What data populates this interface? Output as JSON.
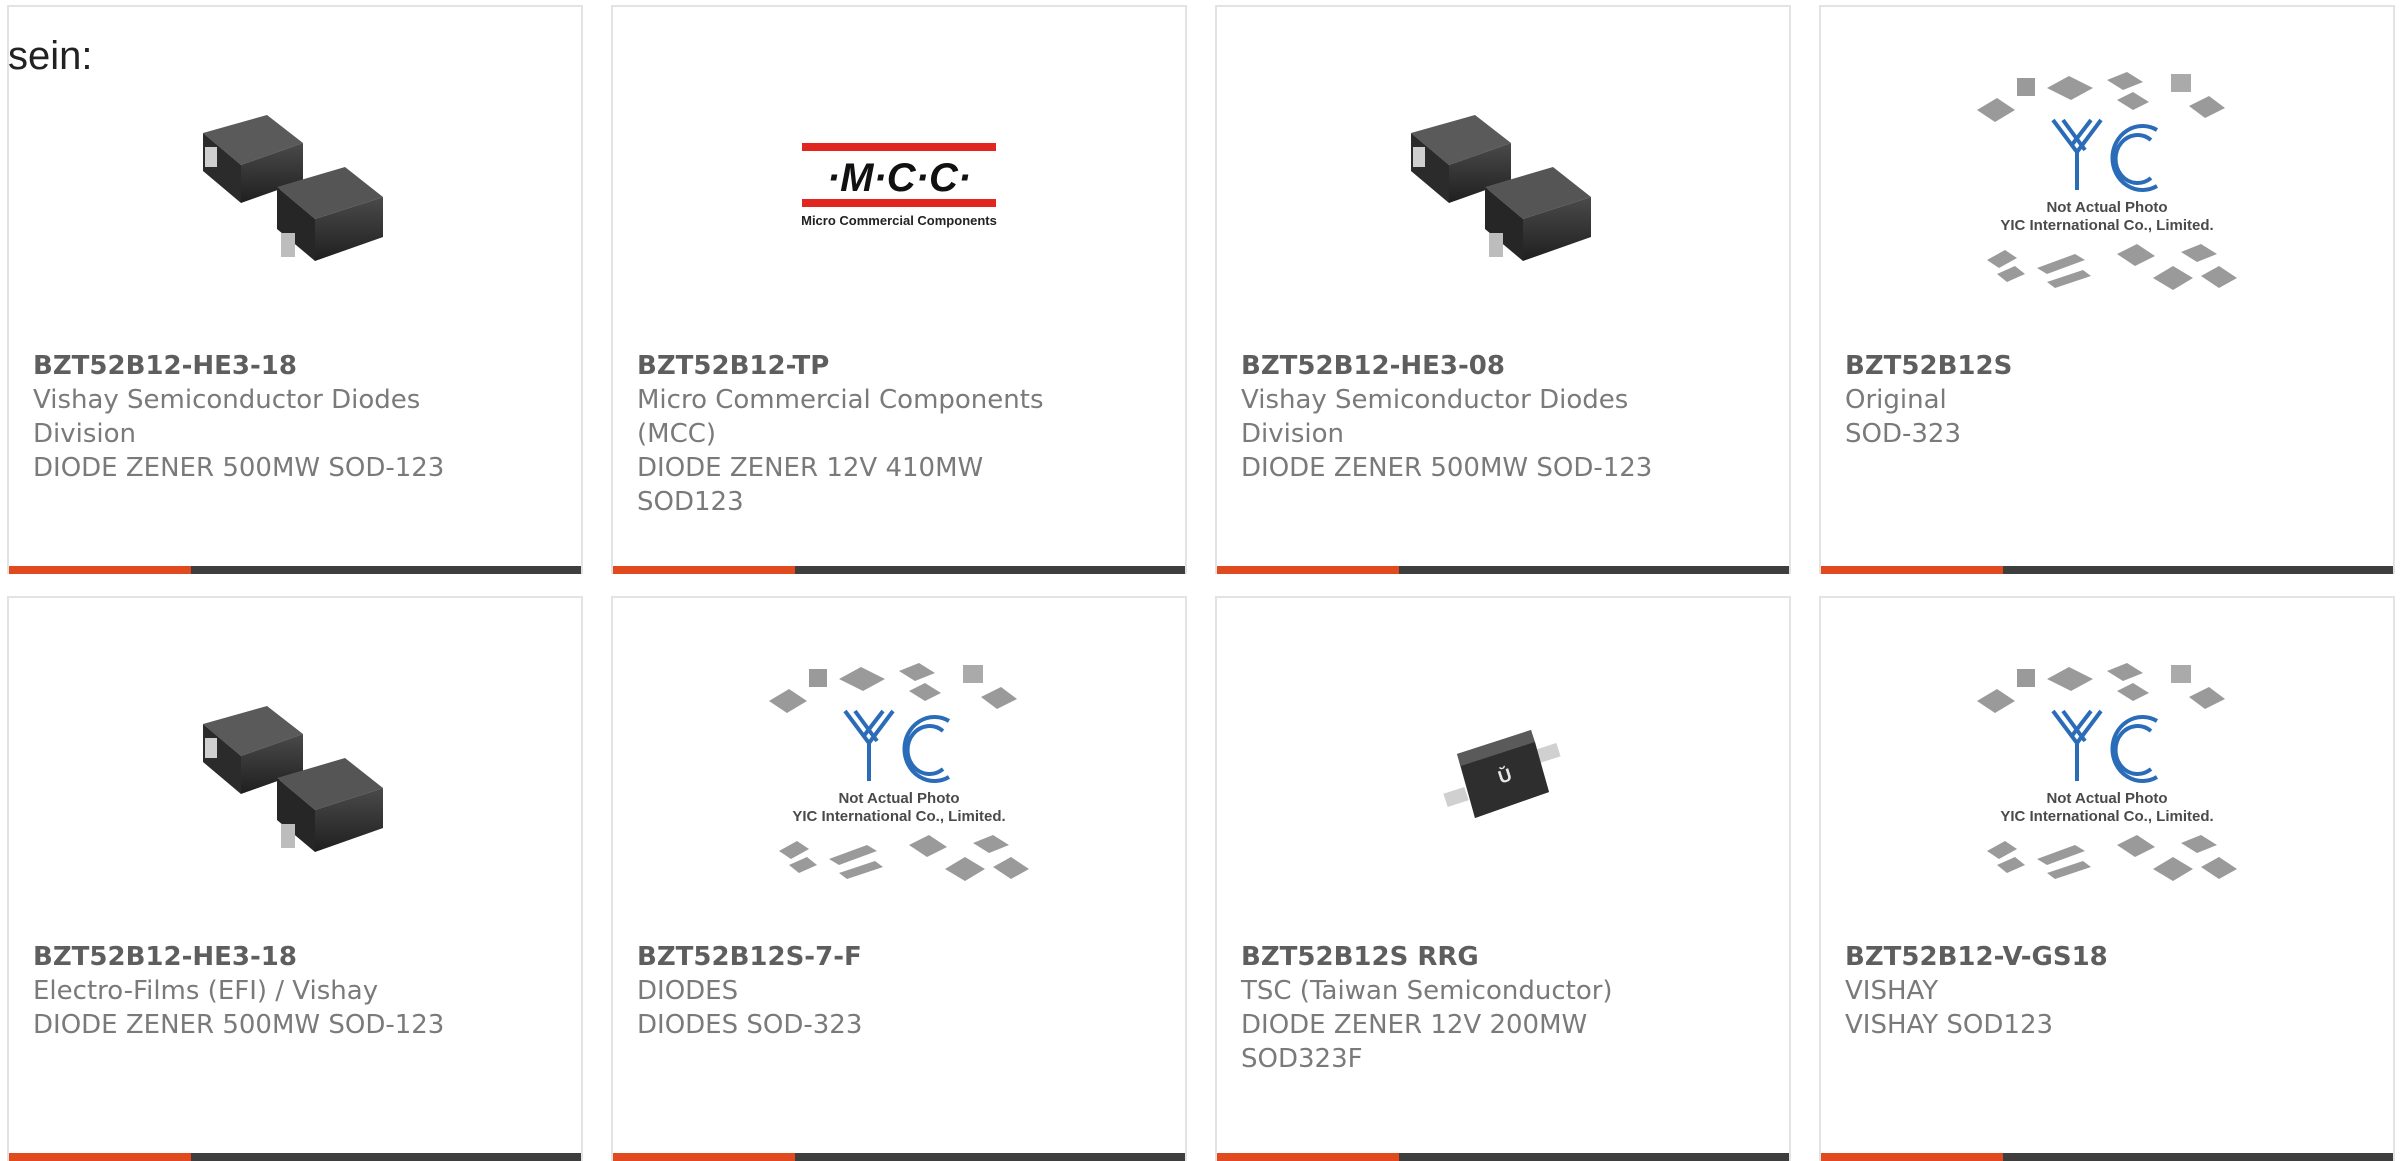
{
  "intro_text": "sein:",
  "colors": {
    "accent": "#e04a1e",
    "bar": "#3e3e3e",
    "card_border": "#e3e3e3",
    "text": "#7a7a7a"
  },
  "products": [
    {
      "part_number": "BZT52B12-HE3-18",
      "manufacturer": "Vishay Semiconductor Diodes Division",
      "description": "DIODE ZENER 500MW SOD-123",
      "image": "sod123-package-photo"
    },
    {
      "part_number": "BZT52B12-TP",
      "manufacturer": "Micro Commercial Components (MCC)",
      "description": "DIODE ZENER 12V 410MW SOD123",
      "image": "mcc-logo",
      "logo_text": "·M·C·C·",
      "logo_subtext": "Micro Commercial Components"
    },
    {
      "part_number": "BZT52B12-HE3-08",
      "manufacturer": "Vishay Semiconductor Diodes Division",
      "description": "DIODE ZENER 500MW SOD-123",
      "image": "sod123-package-photo"
    },
    {
      "part_number": "BZT52B12S",
      "manufacturer": "Original",
      "description": "SOD-323",
      "image": "yic-placeholder",
      "placeholder_line1": "Not Actual Photo",
      "placeholder_line2": "YIC International Co., Limited."
    },
    {
      "part_number": "BZT52B12-HE3-18",
      "manufacturer": "Electro-Films (EFI) / Vishay",
      "description": "DIODE ZENER 500MW SOD-123",
      "image": "sod123-package-photo"
    },
    {
      "part_number": "BZT52B12S-7-F",
      "manufacturer": "DIODES",
      "description": "DIODES SOD-323",
      "image": "yic-placeholder",
      "placeholder_line1": "Not Actual Photo",
      "placeholder_line2": "YIC International Co., Limited."
    },
    {
      "part_number": "BZT52B12S RRG",
      "manufacturer": "TSC (Taiwan Semiconductor)",
      "description": "DIODE ZENER 12V 200MW SOD323F",
      "image": "sod323f-package-photo"
    },
    {
      "part_number": "BZT52B12-V-GS18",
      "manufacturer": "VISHAY",
      "description": "VISHAY SOD123",
      "image": "yic-placeholder",
      "placeholder_line1": "Not Actual Photo",
      "placeholder_line2": "YIC International Co., Limited."
    }
  ]
}
